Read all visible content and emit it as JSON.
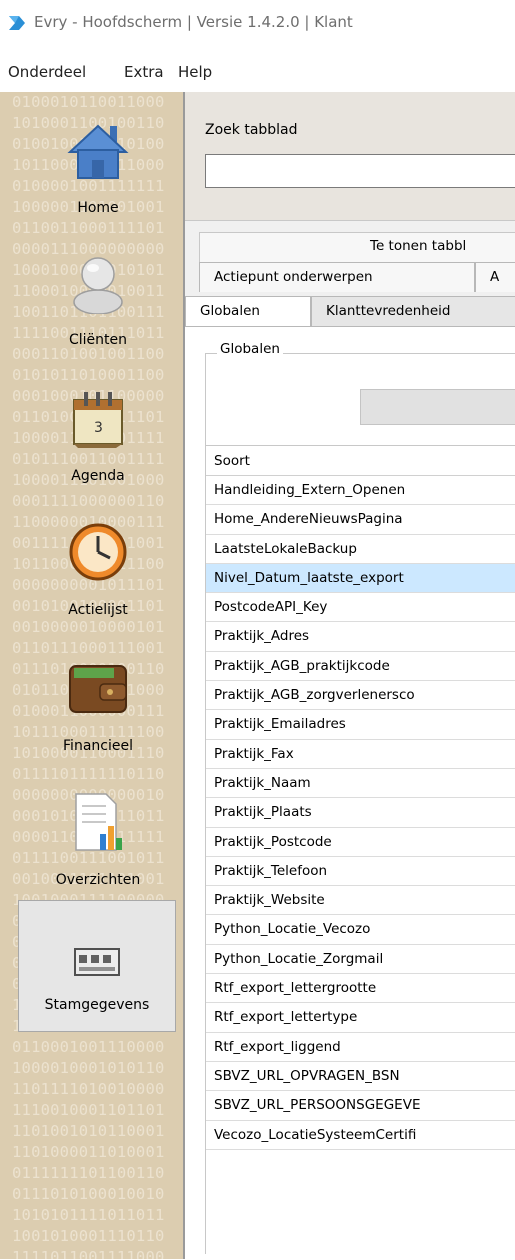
{
  "window": {
    "title": "Evry - Hoofdscherm | Versie 1.4.2.0 | Klant"
  },
  "menu": {
    "items": [
      "Onderdeel",
      "Extra",
      "Help"
    ]
  },
  "sidebar": {
    "items": [
      {
        "label": "Home",
        "icon": "house-icon"
      },
      {
        "label": "Cliënten",
        "icon": "person-icon"
      },
      {
        "label": "Agenda",
        "icon": "calendar-icon"
      },
      {
        "label": "Actielijst",
        "icon": "clock-icon"
      },
      {
        "label": "Financieel",
        "icon": "wallet-icon"
      },
      {
        "label": "Overzichten",
        "icon": "report-icon"
      },
      {
        "label": "Stamgegevens",
        "icon": "database-icon"
      }
    ],
    "selected": "Stamgegevens"
  },
  "search": {
    "label": "Zoek tabblad",
    "value": ""
  },
  "tabs": {
    "header": "Te tonen tabbl",
    "row1": [
      "Actiepunt onderwerpen",
      "A"
    ],
    "row2": [
      "Globalen",
      "Klanttevredenheid"
    ],
    "active": "Globalen"
  },
  "globalen": {
    "group_title": "Globalen",
    "table": {
      "header": "Soort",
      "rows": [
        "Handleiding_Extern_Openen",
        "Home_AndereNieuwsPagina",
        "LaatsteLokaleBackup",
        "Nivel_Datum_laatste_export",
        "PostcodeAPI_Key",
        "Praktijk_Adres",
        "Praktijk_AGB_praktijkcode",
        "Praktijk_AGB_zorgverlenersco",
        "Praktijk_Emailadres",
        "Praktijk_Fax",
        "Praktijk_Naam",
        "Praktijk_Plaats",
        "Praktijk_Postcode",
        "Praktijk_Telefoon",
        "Praktijk_Website",
        "Python_Locatie_Vecozo",
        "Python_Locatie_Zorgmail",
        "Rtf_export_lettergrootte",
        "Rtf_export_lettertype",
        "Rtf_export_liggend",
        "SBVZ_URL_OPVRAGEN_BSN",
        "SBVZ_URL_PERSOONSGEGEVE",
        "Vecozo_LocatieSysteemCertifi"
      ],
      "selected_row": "Nivel_Datum_laatste_export"
    }
  },
  "colors": {
    "sidebar_bg": "#dccdb0",
    "selected_row": "#cce8ff",
    "title_text": "#6e6e6e"
  }
}
